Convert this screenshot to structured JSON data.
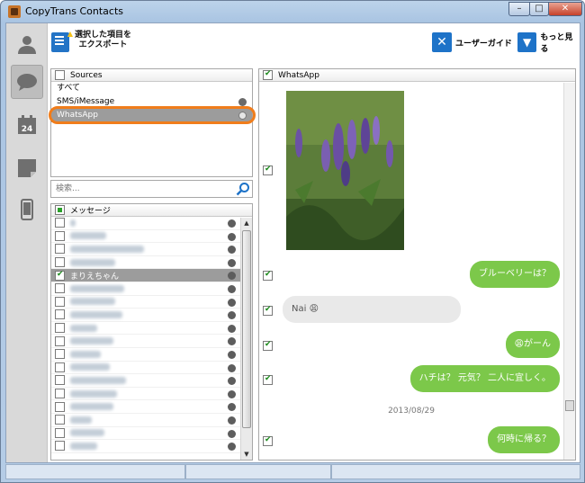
{
  "window": {
    "title": "CopyTrans Contacts",
    "min": "–",
    "max": "□",
    "close": "✕"
  },
  "toolbar": {
    "export_line1": "選択した項目を",
    "export_line2": "エクスポート",
    "guide": "ユーザーガイド",
    "more": "もっと見る"
  },
  "sources": {
    "header": "Sources",
    "items": [
      {
        "label": "すべて",
        "selected": false
      },
      {
        "label": "SMS/iMessage",
        "selected": false
      },
      {
        "label": "WhatsApp",
        "selected": true
      }
    ]
  },
  "search": {
    "placeholder": "検索..."
  },
  "contacts": {
    "header": "メッセージ",
    "selected_name": "まりえちゃん",
    "row_count_blurred_above": 4,
    "row_count_blurred_below": 13
  },
  "messages": {
    "header": "WhatsApp",
    "items": [
      {
        "type": "out",
        "text": "ブルーベリーは？"
      },
      {
        "type": "in",
        "text": "Nai 😩"
      },
      {
        "type": "out",
        "text": "😩がーん"
      },
      {
        "type": "out",
        "text": "ハチは？ 元気？ 二人に宜しく。"
      },
      {
        "type": "date",
        "text": "2013/08/29"
      },
      {
        "type": "out",
        "text": "何時に帰る？"
      }
    ]
  },
  "colors": {
    "accent_green": "#7cc84a",
    "highlight_orange": "#f07d1b",
    "selection": "#9c9c9c"
  }
}
